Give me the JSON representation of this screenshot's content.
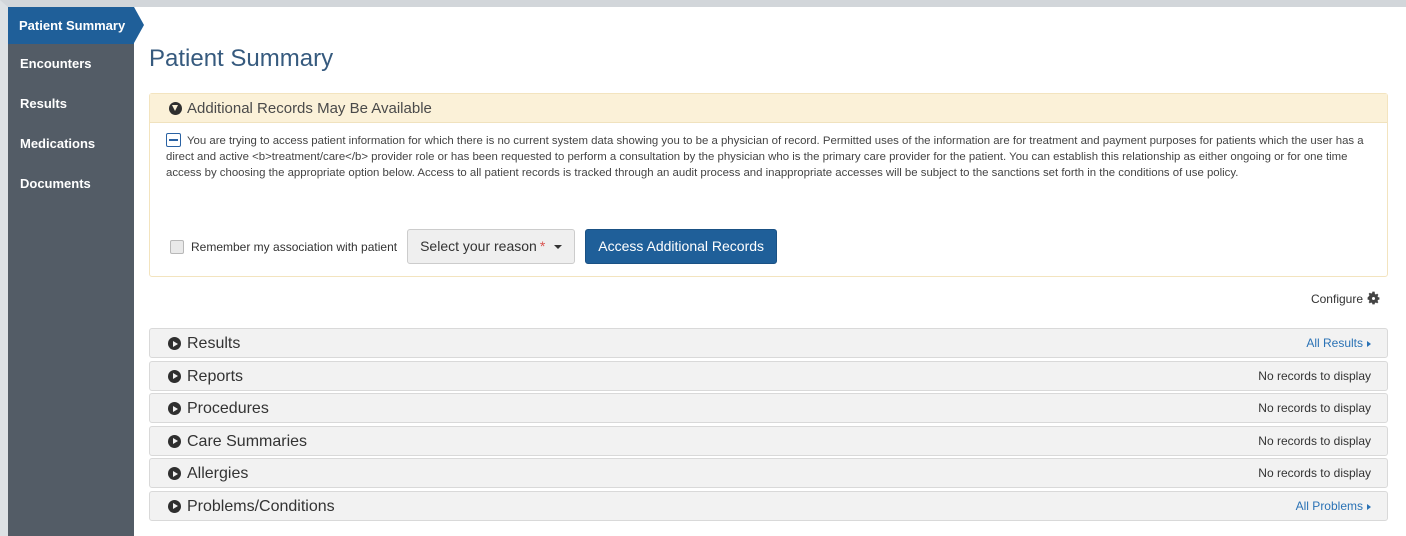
{
  "sidebar": {
    "items": [
      {
        "label": "Patient Summary",
        "active": true
      },
      {
        "label": "Encounters"
      },
      {
        "label": "Results"
      },
      {
        "label": "Medications"
      },
      {
        "label": "Documents"
      }
    ]
  },
  "page": {
    "title": "Patient Summary"
  },
  "alert": {
    "title": "Additional Records May Be Available",
    "body": "You are trying to access patient information for which there is no current system data showing you to be a physician of record. Permitted uses of the information are for treatment and payment purposes for patients which the user has a direct and active <b>treatment/care</b> provider role or has been requested to perform a consultation by the physician who is the primary care provider for the patient. You can establish this relationship as either ongoing or for one time access by choosing the appropriate option below. Access to all patient records is tracked through an audit process and inappropriate accesses will be subject to the sanctions set forth in the conditions of use policy.",
    "checkbox_label": "Remember my association with patient",
    "select_label": "Select your reason",
    "select_required_mark": "*",
    "button_label": "Access Additional Records"
  },
  "configure_label": "Configure",
  "panels": [
    {
      "title": "Results",
      "right": "All Results",
      "is_link": true
    },
    {
      "title": "Reports",
      "right": "No records to display",
      "is_link": false
    },
    {
      "title": "Procedures",
      "right": "No records to display",
      "is_link": false
    },
    {
      "title": "Care Summaries",
      "right": "No records to display",
      "is_link": false
    },
    {
      "title": "Allergies",
      "right": "No records to display",
      "is_link": false
    },
    {
      "title": "Problems/Conditions",
      "right": "All Problems",
      "is_link": true
    }
  ],
  "colors": {
    "sidebar_bg": "#535c66",
    "accent": "#1f5f99",
    "alert_bg": "#fbf1d8",
    "link": "#2a72b5",
    "title": "#365a7e"
  }
}
